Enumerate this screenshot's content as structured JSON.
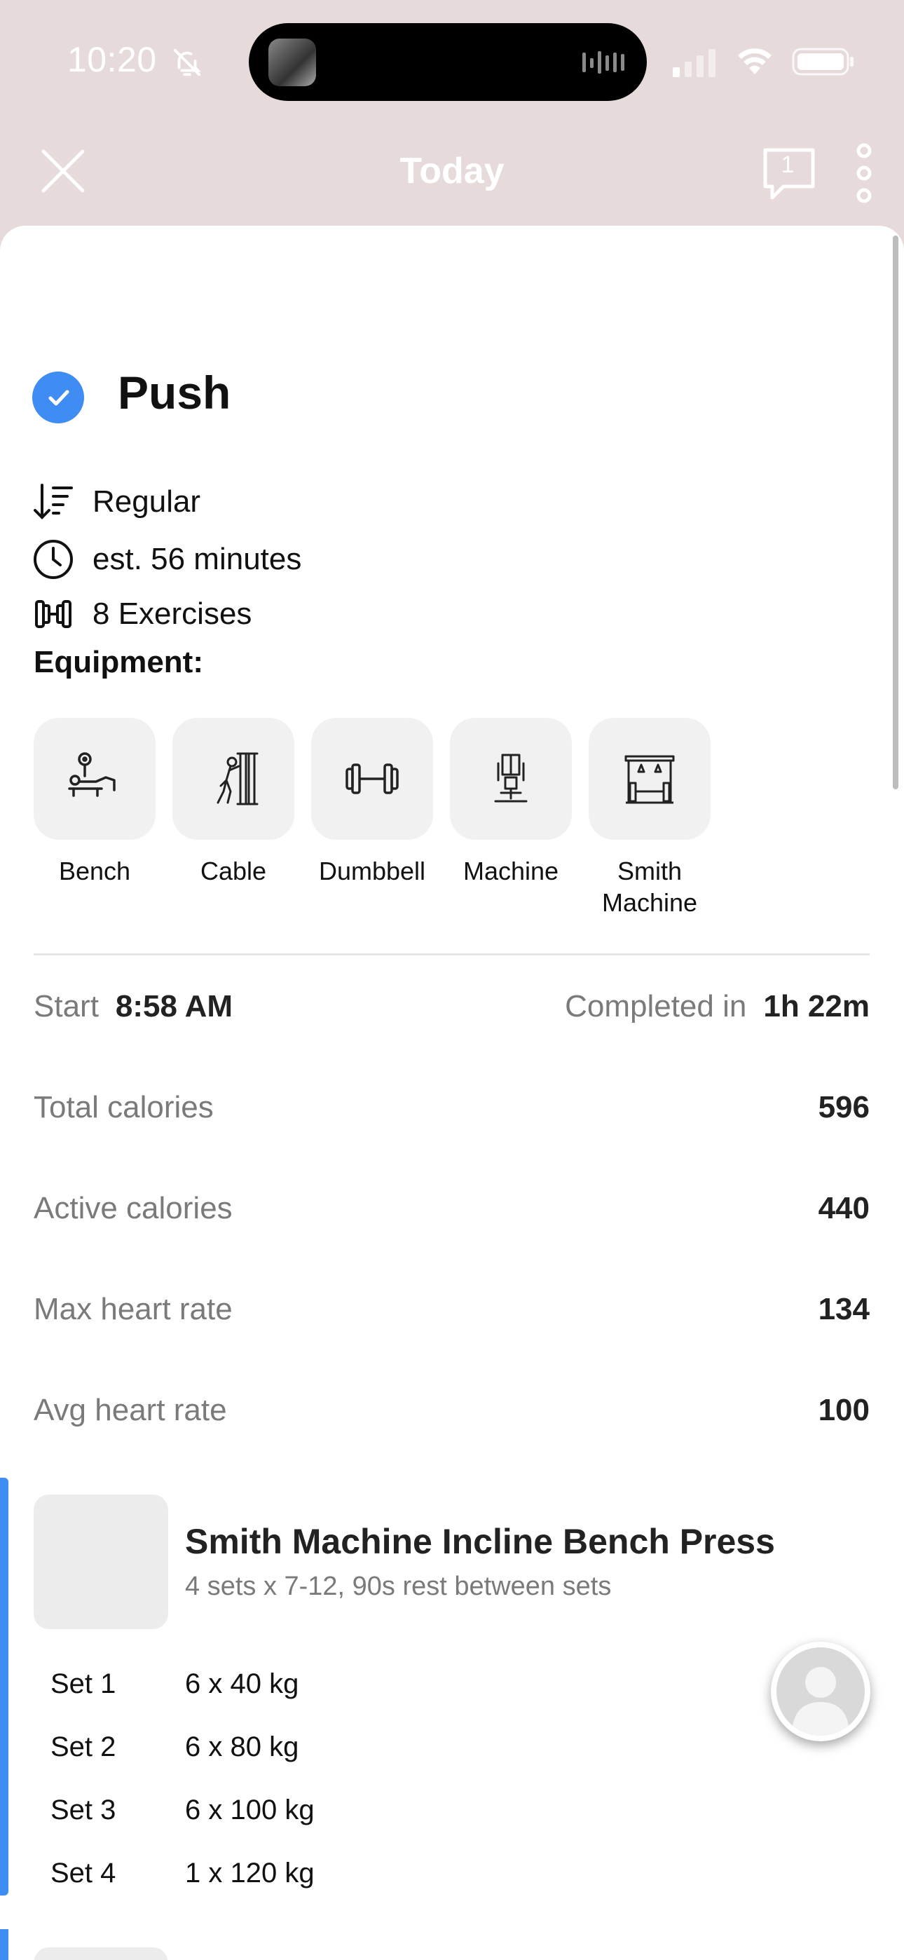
{
  "status_bar": {
    "time": "10:20"
  },
  "nav": {
    "title": "Today",
    "comment_count": "1"
  },
  "workout": {
    "title": "Push",
    "type": "Regular",
    "duration": "est. 56 minutes",
    "exercise_count": "8 Exercises"
  },
  "equipment": {
    "label": "Equipment:",
    "items": [
      {
        "name": "Bench",
        "icon": "bench-icon"
      },
      {
        "name": "Cable",
        "icon": "cable-icon"
      },
      {
        "name": "Dumbbell",
        "icon": "dumbbell-icon"
      },
      {
        "name": "Machine",
        "icon": "machine-icon"
      },
      {
        "name": "Smith\nMachine",
        "icon": "smith-machine-icon"
      }
    ]
  },
  "stats": {
    "start_label": "Start",
    "start_value": "8:58 AM",
    "completed_label": "Completed in",
    "completed_value": "1h 22m",
    "rows": [
      {
        "label": "Total calories",
        "value": "596"
      },
      {
        "label": "Active calories",
        "value": "440"
      },
      {
        "label": "Max heart rate",
        "value": "134"
      },
      {
        "label": "Avg heart rate",
        "value": "100"
      }
    ]
  },
  "exercise": {
    "name": "Smith Machine Incline Bench Press",
    "subtitle": "4 sets x 7-12, 90s rest between sets",
    "sets": [
      {
        "label": "Set 1",
        "value": "6 x 40 kg"
      },
      {
        "label": "Set 2",
        "value": "6 x 80 kg"
      },
      {
        "label": "Set 3",
        "value": "6 x 100 kg"
      },
      {
        "label": "Set 4",
        "value": "1 x 120 kg"
      }
    ]
  },
  "colors": {
    "accent": "#3f8cf2",
    "header_bg": "#e6dadb"
  }
}
